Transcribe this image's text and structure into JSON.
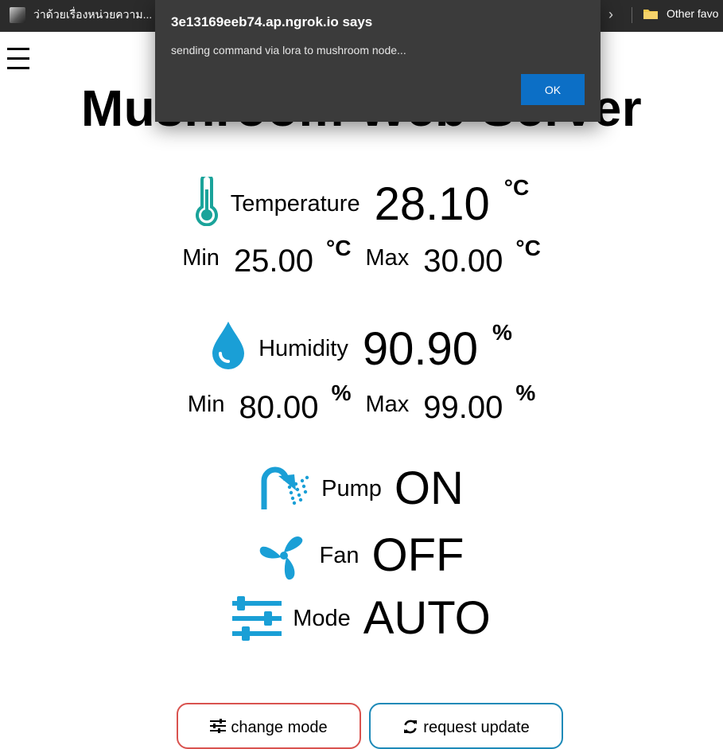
{
  "browser": {
    "tab_title": "ว่าด้วยเรื่องหน่วยความ...",
    "other_favorites": "Other favo"
  },
  "page": {
    "title": "Mushroom Web Server"
  },
  "temperature": {
    "label": "Temperature",
    "value": "28.10",
    "unit": "°C",
    "min_label": "Min",
    "min_value": "25.00",
    "max_label": "Max",
    "max_value": "30.00"
  },
  "humidity": {
    "label": "Humidity",
    "value": "90.90",
    "unit": "%",
    "min_label": "Min",
    "min_value": "80.00",
    "max_label": "Max",
    "max_value": "99.00"
  },
  "status": {
    "pump_label": "Pump",
    "pump_value": "ON",
    "fan_label": "Fan",
    "fan_value": "OFF",
    "mode_label": "Mode",
    "mode_value": "AUTO"
  },
  "buttons": {
    "change_mode": "change mode",
    "request_update": "request update"
  },
  "dialog": {
    "title": "3e13169eeb74.ap.ngrok.io says",
    "message": "sending command via lora to mushroom node...",
    "ok": "OK"
  },
  "colors": {
    "icon_teal": "#1aa39a",
    "icon_blue": "#1a9fd6",
    "change_mode_border": "#d9534f",
    "request_update_border": "#1e8ab8",
    "ok_button": "#0c6fc6"
  },
  "icons": [
    "thermometer-icon",
    "water-drop-icon",
    "shower-icon",
    "fan-icon",
    "sliders-icon",
    "refresh-icon",
    "folder-icon",
    "menu-icon"
  ]
}
